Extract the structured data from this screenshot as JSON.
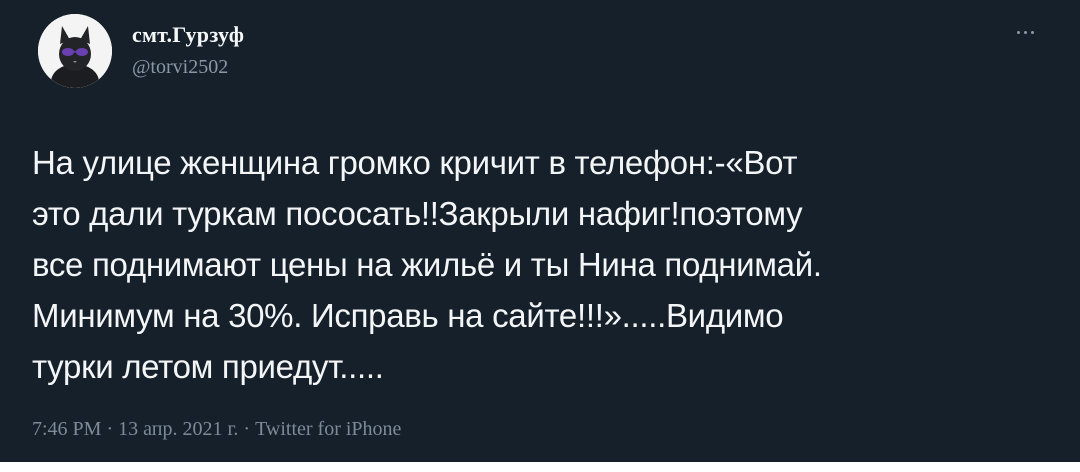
{
  "tweet": {
    "author_name": "смт.Гурзуф",
    "handle": "@torvi2502",
    "text_lines": [
      "На улице женщина громко кричит в телефон:-«Вот",
      "это дали туркам пососать!!Закрыли нафиг!поэтому",
      "все поднимают цены на жильё и ты Нина поднимай.",
      "Минимум на 30%. Исправь на сайте!!!».....Видимо",
      "турки летом приедут....."
    ],
    "time": "7:46 PM",
    "separator": "·",
    "date": "13 апр. 2021 г.",
    "source": "Twitter for iPhone"
  },
  "icons": {
    "avatar": "cat-with-sunglasses-avatar",
    "more": "more-options-icon"
  },
  "colors": {
    "background": "#16202a",
    "primary_text": "#f3f5f6",
    "secondary_text": "#8a98a5"
  }
}
